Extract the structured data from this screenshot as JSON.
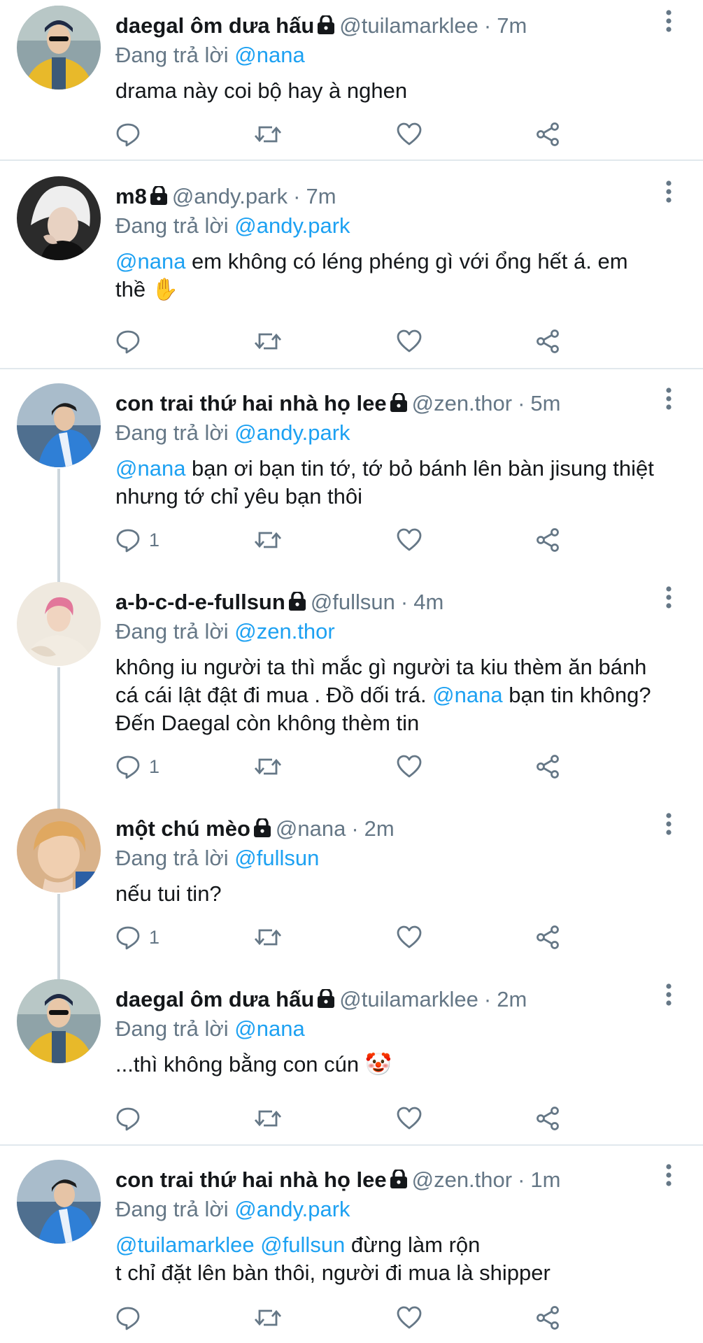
{
  "colors": {
    "link": "#1da1f2",
    "secondary": "#657786",
    "divider": "#e1e8ed",
    "thread_line": "#ccd6dd"
  },
  "tweets": [
    {
      "display_name": "daegal ôm dưa hấu",
      "handle": "@tuilamarklee",
      "separator": "·",
      "time": "7m",
      "reply_prefix": "Đang trả lời",
      "reply_to": "@nana",
      "text_mention": "",
      "text_mention2": "",
      "text": "drama này coi bộ hay à nghen",
      "reply_count": "",
      "avatar_icon": "avatar-yellow-jacket-icon"
    },
    {
      "display_name": "m8",
      "handle": "@andy.park",
      "separator": "·",
      "time": "7m",
      "reply_prefix": "Đang trả lời",
      "reply_to": "@andy.park",
      "text_mention": "@nana",
      "text_mention2": "",
      "text": " em không có léng phéng gì với ổng hết á. em thề ✋",
      "reply_count": "",
      "avatar_icon": "avatar-white-hair-icon"
    },
    {
      "display_name": "con trai thứ hai nhà họ lee",
      "handle": "@zen.thor",
      "separator": "·",
      "time": "5m",
      "reply_prefix": "Đang trả lời",
      "reply_to": "@andy.park",
      "text_mention": "@nana",
      "text_mention2": "",
      "text": " bạn ơi bạn tin tớ, tớ bỏ bánh lên bàn jisung thiệt nhưng tớ chỉ yêu bạn thôi",
      "reply_count": "1",
      "avatar_icon": "avatar-blue-jacket-icon"
    },
    {
      "display_name": "a-b-c-d-e-fullsun",
      "handle": "@fullsun",
      "separator": "·",
      "time": "4m",
      "reply_prefix": "Đang trả lời",
      "reply_to": "@zen.thor",
      "text_before": "không iu người ta thì mắc gì người ta kiu thèm ăn bánh cá cái lật đật đi mua . Đồ dối trá. ",
      "text_mention": "@nana",
      "text_after": " bạn tin không? Đến Daegal còn không thèm tin",
      "reply_count": "1",
      "avatar_icon": "avatar-pink-hair-icon"
    },
    {
      "display_name": "một chú mèo",
      "handle": "@nana",
      "separator": "·",
      "time": "2m",
      "reply_prefix": "Đang trả lời",
      "reply_to": "@fullsun",
      "text_mention": "",
      "text_mention2": "",
      "text": "nếu tui tin?",
      "reply_count": "1",
      "avatar_icon": "avatar-blonde-icon"
    },
    {
      "display_name": "daegal ôm dưa hấu",
      "handle": "@tuilamarklee",
      "separator": "·",
      "time": "2m",
      "reply_prefix": "Đang trả lời",
      "reply_to": "@nana",
      "text_mention": "",
      "text_mention2": "",
      "text": "...thì không bằng con cún 🤡",
      "reply_count": "",
      "avatar_icon": "avatar-yellow-jacket-icon"
    },
    {
      "display_name": "con trai thứ hai nhà họ lee",
      "handle": "@zen.thor",
      "separator": "·",
      "time": "1m",
      "reply_prefix": "Đang trả lời",
      "reply_to": "@andy.park",
      "text_mention": "@tuilamarklee",
      "text_mention2": "@fullsun",
      "text": " đừng làm rộn",
      "text_line2": "t chỉ đặt lên bàn thôi, người đi mua là shipper",
      "reply_count": "",
      "avatar_icon": "avatar-blue-jacket-icon"
    }
  ]
}
